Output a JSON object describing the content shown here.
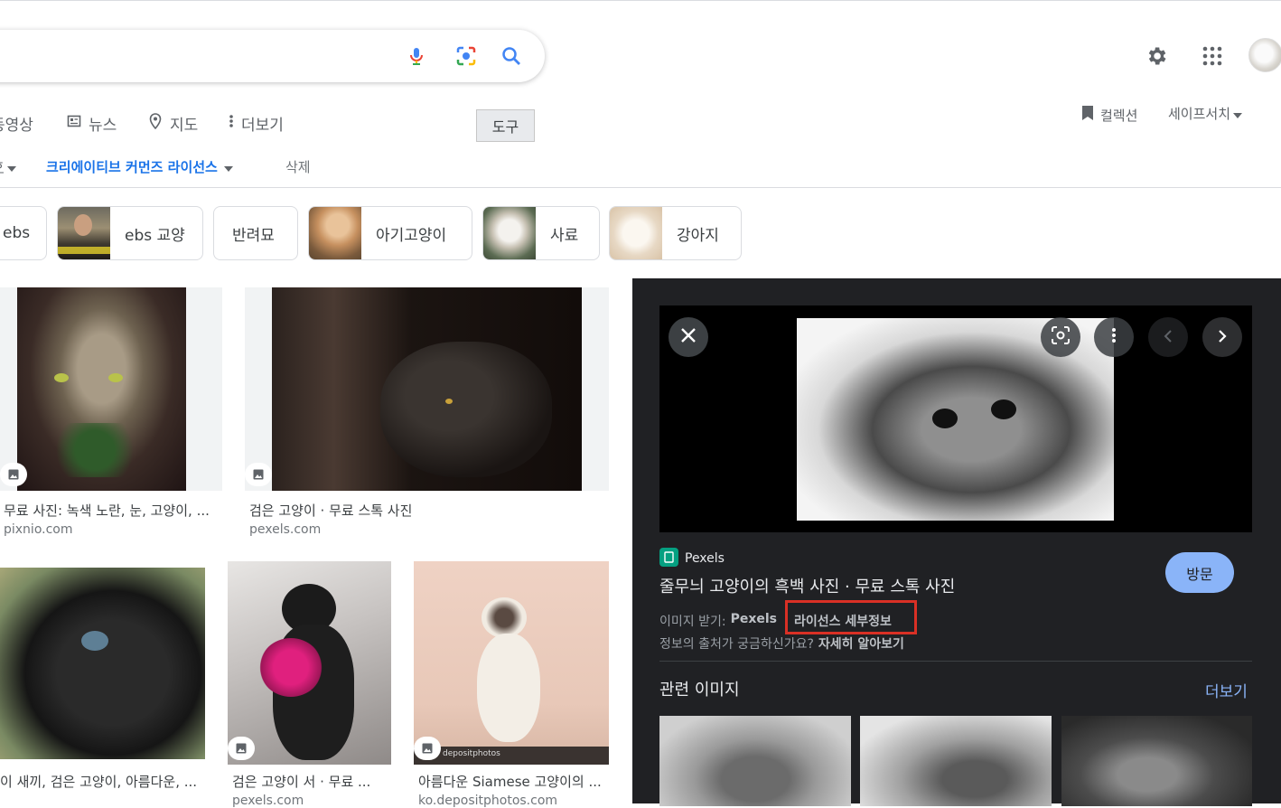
{
  "search": {
    "value": "",
    "placeholder": ""
  },
  "tabs": [
    {
      "label": "동영상"
    },
    {
      "label": "뉴스"
    },
    {
      "label": "지도"
    },
    {
      "label": "더보기"
    }
  ],
  "tools_label": "도구",
  "collections_label": "컬렉션",
  "safesearch_label": "세이프서치",
  "filters": {
    "license": "크리에이티브 커먼즈 라이선스",
    "clear": "삭제"
  },
  "chips": [
    {
      "label": "ebs"
    },
    {
      "label": "ebs 교양"
    },
    {
      "label": "반려묘"
    },
    {
      "label": "아기고양이"
    },
    {
      "label": "사료"
    },
    {
      "label": "강아지"
    }
  ],
  "results": [
    {
      "caption": "무료 사진: 녹색 노란, 눈, 고양이, ...",
      "source": "pixnio.com"
    },
    {
      "caption": "검은 고양이 · 무료 스톡 사진",
      "source": "pexels.com"
    },
    {
      "caption": "이 새끼, 검은 고양이, 아름다운, ...",
      "source": ""
    },
    {
      "caption": "검은 고양이 서 · 무료 ...",
      "source": "pexels.com"
    },
    {
      "caption": "아름다운 Siamese 고양이의 ...",
      "source": "ko.depositphotos.com"
    }
  ],
  "panel": {
    "source_name": "Pexels",
    "title": "줄무늬 고양이의 흑백 사진 · 무료 스톡 사진",
    "get_image_prefix": "이미지 받기:",
    "get_image_source": "Pexels",
    "license_link": "라이선스 세부정보",
    "info_prefix": "정보의 출처가 궁금하신가요?",
    "info_link": "자세히 알아보기",
    "visit_label": "방문",
    "related_title": "관련 이미지",
    "more_label": "더보기",
    "watermark": "depositphotos"
  },
  "colors": {
    "accent_blue": "#1a73e8",
    "panel_bg": "#202124",
    "visit_button": "#8ab4f8",
    "highlight_box": "#d93025"
  }
}
